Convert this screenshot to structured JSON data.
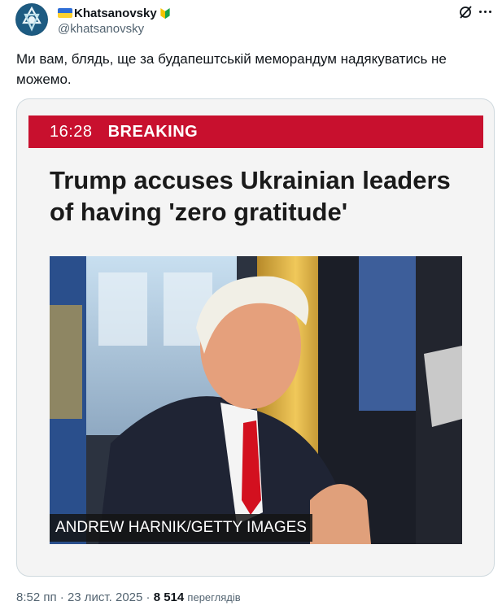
{
  "author": {
    "display_name": "Khatsanovsky",
    "handle": "@khatsanovsky",
    "avatar_icon": "logo-avatar",
    "flag_icon": "ukraine-flag-icon",
    "badge_icon": "beginner-badge-icon"
  },
  "tweet": {
    "text": "Ми вам, блядь, ще за будапештській меморандум надякуватись не можемо."
  },
  "card": {
    "time": "16:28",
    "label": "BREAKING",
    "headline": "Trump accuses Ukrainian leaders of having 'zero gratitude'",
    "photo_credit": "ANDREW HARNIK/GETTY IMAGES",
    "bar_color": "#c8102e"
  },
  "meta": {
    "time": "8:52 пп",
    "separator": "·",
    "date": "23 лист. 2025",
    "views_count": "8 514",
    "views_label": "переглядів"
  }
}
